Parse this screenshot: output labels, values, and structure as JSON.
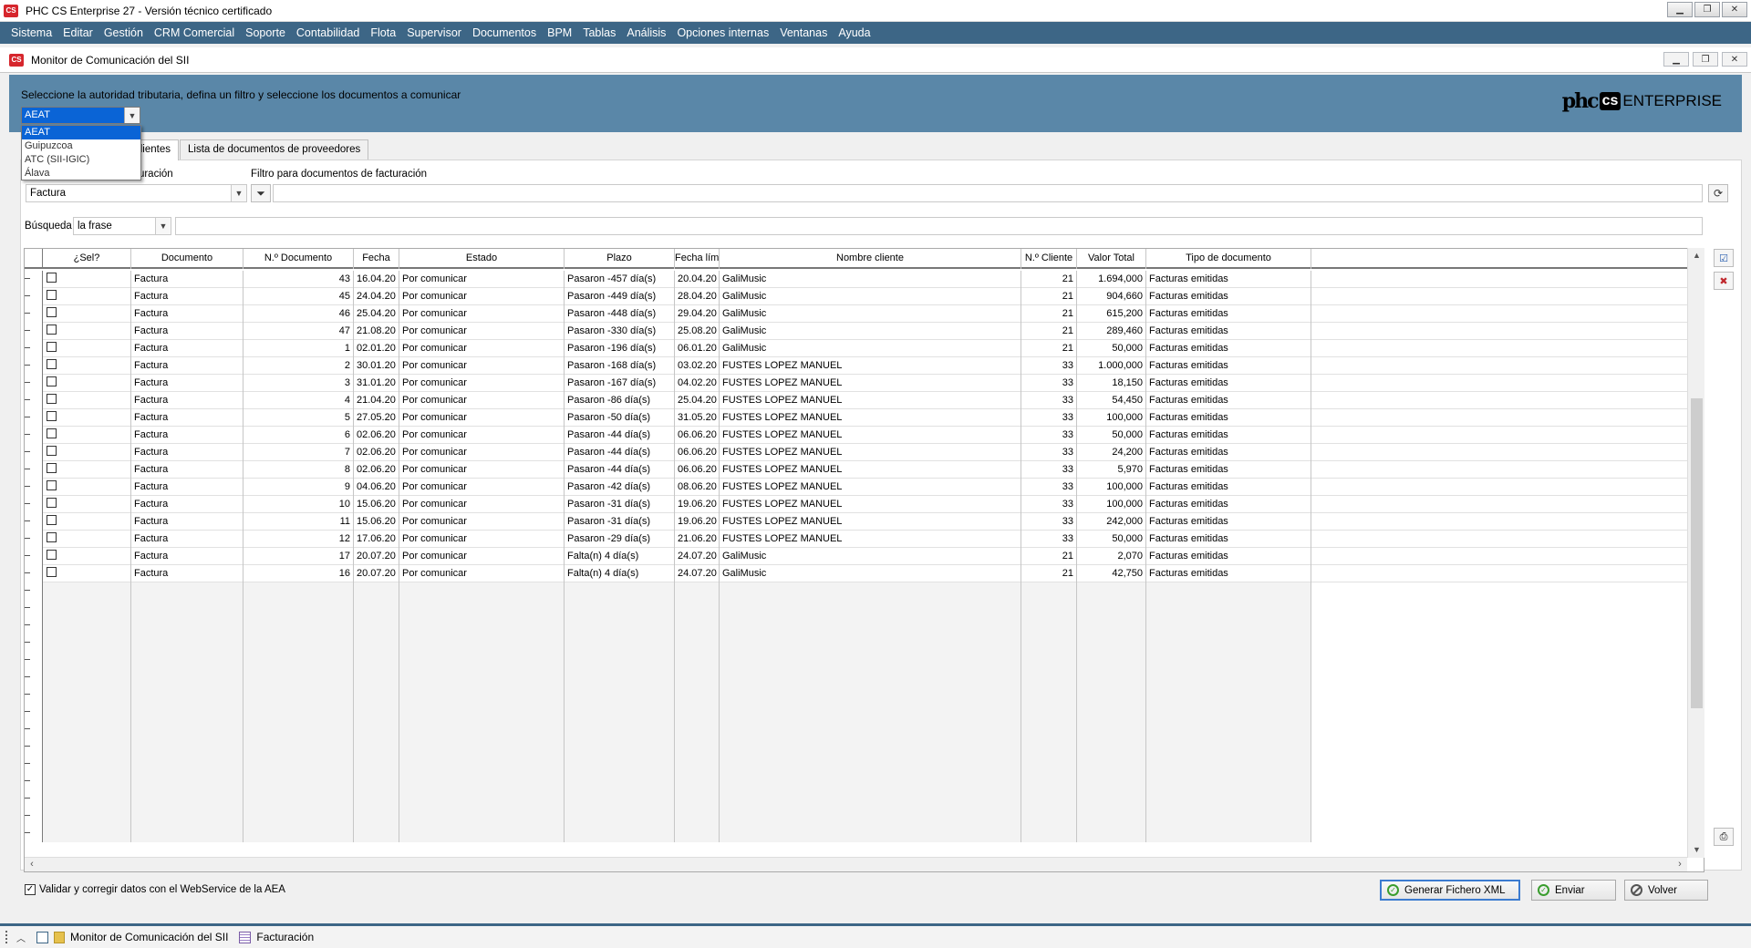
{
  "app": {
    "title": "PHC CS Enterprise 27 - Versión técnico certificado",
    "logo_text": "CS"
  },
  "menu": [
    "Sistema",
    "Editar",
    "Gestión",
    "CRM Comercial",
    "Soporte",
    "Contabilidad",
    "Flota",
    "Supervisor",
    "Documentos",
    "BPM",
    "Tablas",
    "Análisis",
    "Opciones internas",
    "Ventanas",
    "Ayuda"
  ],
  "window": {
    "title": "Monitor de Comunicación del SII"
  },
  "header": {
    "instruction": "Seleccione la autoridad tributaria, defina un filtro y seleccione los documentos a comunicar",
    "brand_phc": "phc",
    "brand_cs": "cs",
    "brand_enterprise": "ENTERPRISE"
  },
  "authority": {
    "selected": "AEAT",
    "options": [
      "AEAT",
      "Guipuzcoa",
      "ATC (SII-IGIC)",
      "Álava"
    ]
  },
  "tabs": [
    {
      "label": "clientes",
      "active": true
    },
    {
      "label": "Lista de documentos de proveedores",
      "active": false
    }
  ],
  "filters": {
    "doc_type_label": "cturación",
    "doc_type_value": "Factura",
    "filter_label": "Filtro para documentos de facturación",
    "filter_value": "",
    "search_label": "Búsqueda",
    "search_mode": "la frase",
    "search_value": ""
  },
  "table": {
    "columns": [
      "¿Sel?",
      "Documento",
      "N.º Documento",
      "Fecha",
      "Estado",
      "Plazo",
      "Fecha lím",
      "Nombre cliente",
      "N.º Cliente",
      "Valor Total",
      "Tipo de documento"
    ],
    "rows": [
      {
        "doc": "Factura",
        "num": "43",
        "fecha": "16.04.20",
        "estado": "Por comunicar",
        "plazo": "Pasaron -457 día(s)",
        "lim": "20.04.20",
        "cliente": "GaliMusic",
        "ncli": "21",
        "total": "1.694,000",
        "tipo": "Facturas emitidas"
      },
      {
        "doc": "Factura",
        "num": "45",
        "fecha": "24.04.20",
        "estado": "Por comunicar",
        "plazo": "Pasaron -449 día(s)",
        "lim": "28.04.20",
        "cliente": "GaliMusic",
        "ncli": "21",
        "total": "904,660",
        "tipo": "Facturas emitidas"
      },
      {
        "doc": "Factura",
        "num": "46",
        "fecha": "25.04.20",
        "estado": "Por comunicar",
        "plazo": "Pasaron -448 día(s)",
        "lim": "29.04.20",
        "cliente": "GaliMusic",
        "ncli": "21",
        "total": "615,200",
        "tipo": "Facturas emitidas"
      },
      {
        "doc": "Factura",
        "num": "47",
        "fecha": "21.08.20",
        "estado": "Por comunicar",
        "plazo": "Pasaron -330 día(s)",
        "lim": "25.08.20",
        "cliente": "GaliMusic",
        "ncli": "21",
        "total": "289,460",
        "tipo": "Facturas emitidas"
      },
      {
        "doc": "Factura",
        "num": "1",
        "fecha": "02.01.20",
        "estado": "Por comunicar",
        "plazo": "Pasaron -196 día(s)",
        "lim": "06.01.20",
        "cliente": "GaliMusic",
        "ncli": "21",
        "total": "50,000",
        "tipo": "Facturas emitidas"
      },
      {
        "doc": "Factura",
        "num": "2",
        "fecha": "30.01.20",
        "estado": "Por comunicar",
        "plazo": "Pasaron -168 día(s)",
        "lim": "03.02.20",
        "cliente": "FUSTES LOPEZ MANUEL",
        "ncli": "33",
        "total": "1.000,000",
        "tipo": "Facturas emitidas"
      },
      {
        "doc": "Factura",
        "num": "3",
        "fecha": "31.01.20",
        "estado": "Por comunicar",
        "plazo": "Pasaron -167 día(s)",
        "lim": "04.02.20",
        "cliente": "FUSTES LOPEZ MANUEL",
        "ncli": "33",
        "total": "18,150",
        "tipo": "Facturas emitidas"
      },
      {
        "doc": "Factura",
        "num": "4",
        "fecha": "21.04.20",
        "estado": "Por comunicar",
        "plazo": "Pasaron -86 día(s)",
        "lim": "25.04.20",
        "cliente": "FUSTES LOPEZ MANUEL",
        "ncli": "33",
        "total": "54,450",
        "tipo": "Facturas emitidas"
      },
      {
        "doc": "Factura",
        "num": "5",
        "fecha": "27.05.20",
        "estado": "Por comunicar",
        "plazo": "Pasaron -50 día(s)",
        "lim": "31.05.20",
        "cliente": "FUSTES LOPEZ MANUEL",
        "ncli": "33",
        "total": "100,000",
        "tipo": "Facturas emitidas"
      },
      {
        "doc": "Factura",
        "num": "6",
        "fecha": "02.06.20",
        "estado": "Por comunicar",
        "plazo": "Pasaron -44 día(s)",
        "lim": "06.06.20",
        "cliente": "FUSTES LOPEZ MANUEL",
        "ncli": "33",
        "total": "50,000",
        "tipo": "Facturas emitidas"
      },
      {
        "doc": "Factura",
        "num": "7",
        "fecha": "02.06.20",
        "estado": "Por comunicar",
        "plazo": "Pasaron -44 día(s)",
        "lim": "06.06.20",
        "cliente": "FUSTES LOPEZ MANUEL",
        "ncli": "33",
        "total": "24,200",
        "tipo": "Facturas emitidas"
      },
      {
        "doc": "Factura",
        "num": "8",
        "fecha": "02.06.20",
        "estado": "Por comunicar",
        "plazo": "Pasaron -44 día(s)",
        "lim": "06.06.20",
        "cliente": "FUSTES LOPEZ MANUEL",
        "ncli": "33",
        "total": "5,970",
        "tipo": "Facturas emitidas"
      },
      {
        "doc": "Factura",
        "num": "9",
        "fecha": "04.06.20",
        "estado": "Por comunicar",
        "plazo": "Pasaron -42 día(s)",
        "lim": "08.06.20",
        "cliente": "FUSTES LOPEZ MANUEL",
        "ncli": "33",
        "total": "100,000",
        "tipo": "Facturas emitidas"
      },
      {
        "doc": "Factura",
        "num": "10",
        "fecha": "15.06.20",
        "estado": "Por comunicar",
        "plazo": "Pasaron -31 día(s)",
        "lim": "19.06.20",
        "cliente": "FUSTES LOPEZ MANUEL",
        "ncli": "33",
        "total": "100,000",
        "tipo": "Facturas emitidas"
      },
      {
        "doc": "Factura",
        "num": "11",
        "fecha": "15.06.20",
        "estado": "Por comunicar",
        "plazo": "Pasaron -31 día(s)",
        "lim": "19.06.20",
        "cliente": "FUSTES LOPEZ MANUEL",
        "ncli": "33",
        "total": "242,000",
        "tipo": "Facturas emitidas"
      },
      {
        "doc": "Factura",
        "num": "12",
        "fecha": "17.06.20",
        "estado": "Por comunicar",
        "plazo": "Pasaron -29 día(s)",
        "lim": "21.06.20",
        "cliente": "FUSTES LOPEZ MANUEL",
        "ncli": "33",
        "total": "50,000",
        "tipo": "Facturas emitidas"
      },
      {
        "doc": "Factura",
        "num": "17",
        "fecha": "20.07.20",
        "estado": "Por comunicar",
        "plazo": "Falta(n) 4 día(s)",
        "lim": "24.07.20",
        "cliente": "GaliMusic",
        "ncli": "21",
        "total": "2,070",
        "tipo": "Facturas emitidas"
      },
      {
        "doc": "Factura",
        "num": "16",
        "fecha": "20.07.20",
        "estado": "Por comunicar",
        "plazo": "Falta(n) 4 día(s)",
        "lim": "24.07.20",
        "cliente": "GaliMusic",
        "ncli": "21",
        "total": "42,750",
        "tipo": "Facturas emitidas"
      }
    ]
  },
  "bottom": {
    "validate_label": "Validar y corregir datos con el WebService de la AEA",
    "validate_checked": true,
    "btn_generate": "Generar Fichero XML",
    "btn_send": "Enviar",
    "btn_back": "Volver"
  },
  "taskbar": {
    "items": [
      "Monitor de Comunicación del SII",
      "Facturación"
    ]
  },
  "colors": {
    "menubar": "#3d6686",
    "panel": "#5a87a8",
    "selection": "#0a64d6",
    "logo": "#d6262d"
  }
}
